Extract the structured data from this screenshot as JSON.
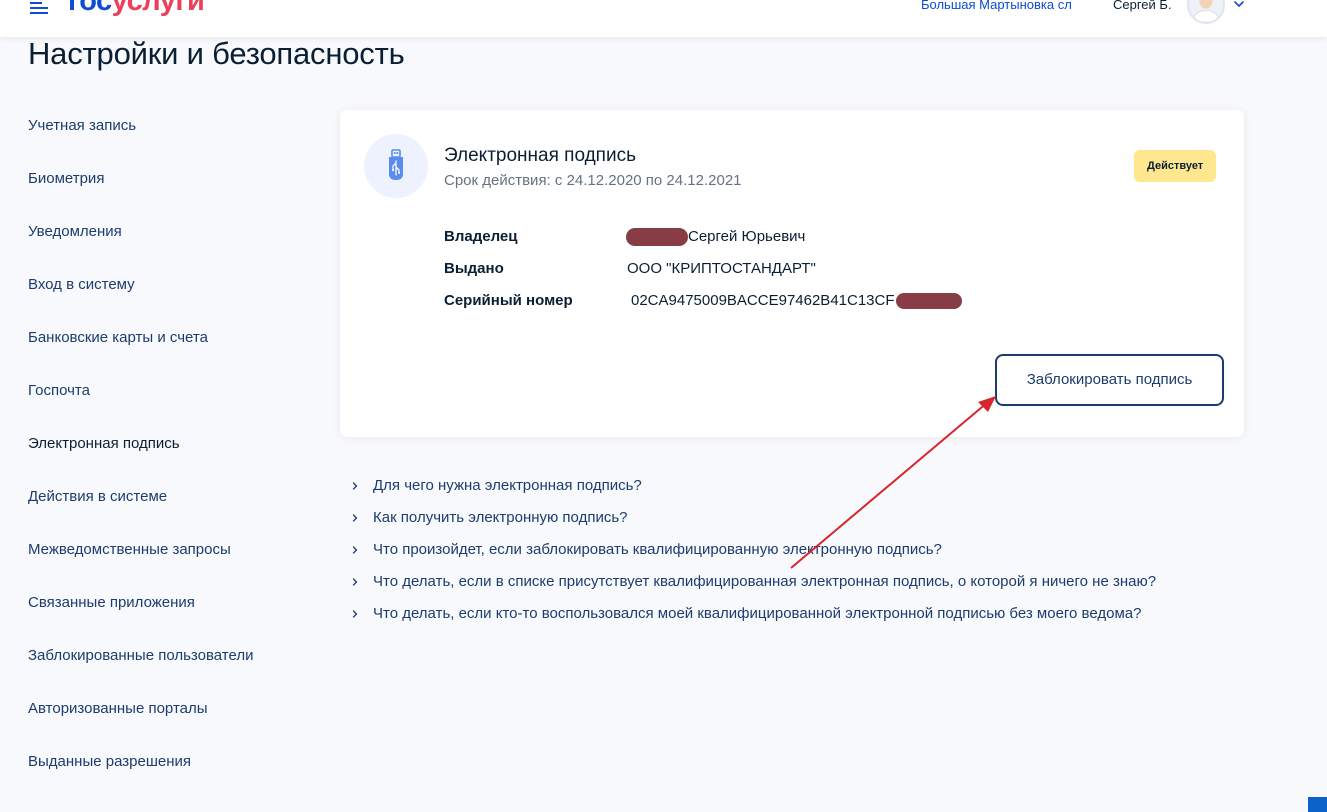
{
  "header": {
    "logo_part1": "гос",
    "logo_part2": "услуги",
    "location": "Большая Мартыновка сл",
    "user_name": "Сергей Б."
  },
  "page": {
    "title": "Настройки и безопасность"
  },
  "sidebar": {
    "items": [
      {
        "label": "Учетная запись"
      },
      {
        "label": "Биометрия"
      },
      {
        "label": "Уведомления"
      },
      {
        "label": "Вход в систему"
      },
      {
        "label": "Банковские карты и счета"
      },
      {
        "label": "Госпочта"
      },
      {
        "label": "Электронная подпись"
      },
      {
        "label": "Действия в системе"
      },
      {
        "label": "Межведомственные запросы"
      },
      {
        "label": "Связанные приложения"
      },
      {
        "label": "Заблокированные пользователи"
      },
      {
        "label": "Авторизованные порталы"
      },
      {
        "label": "Выданные разрешения"
      }
    ],
    "active_index": 6
  },
  "signature_card": {
    "title": "Электронная подпись",
    "validity": "Срок действия: с 24.12.2020 по 24.12.2021",
    "status_badge": "Действует",
    "owner_label": "Владелец",
    "owner_value": "Сергей Юрьевич",
    "issued_label": "Выдано",
    "issued_value": "ООО \"КРИПТОСТАНДАРТ\"",
    "serial_label": "Серийный номер",
    "serial_value": "02CA9475009BACCE97462B41C13CF",
    "block_button": "Заблокировать подпись"
  },
  "faq": {
    "items": [
      {
        "question": "Для чего нужна электронная подпись?"
      },
      {
        "question": "Как получить электронную подпись?"
      },
      {
        "question": "Что произойдет, если заблокировать квалифицированную электронную подпись?"
      },
      {
        "question": "Что делать, если в списке присутствует квалифицированная электронная подпись, о которой я ничего не знаю?"
      },
      {
        "question": "Что делать, если кто-то воспользовался моей квалифицированной электронной подписью без моего ведома?"
      }
    ]
  },
  "colors": {
    "brand_blue": "#0d4cd3",
    "brand_red": "#ee3f58",
    "link_text": "#1d3c6e",
    "badge_bg": "#fee78e",
    "annotation_arrow": "#d6262b",
    "redaction": "#7d2b36"
  },
  "icons": {
    "menu": "hamburger-menu-icon",
    "user_dropdown": "chevron-down-icon",
    "card": "usb-token-icon",
    "faq_bullet": "chevron-right-icon"
  }
}
